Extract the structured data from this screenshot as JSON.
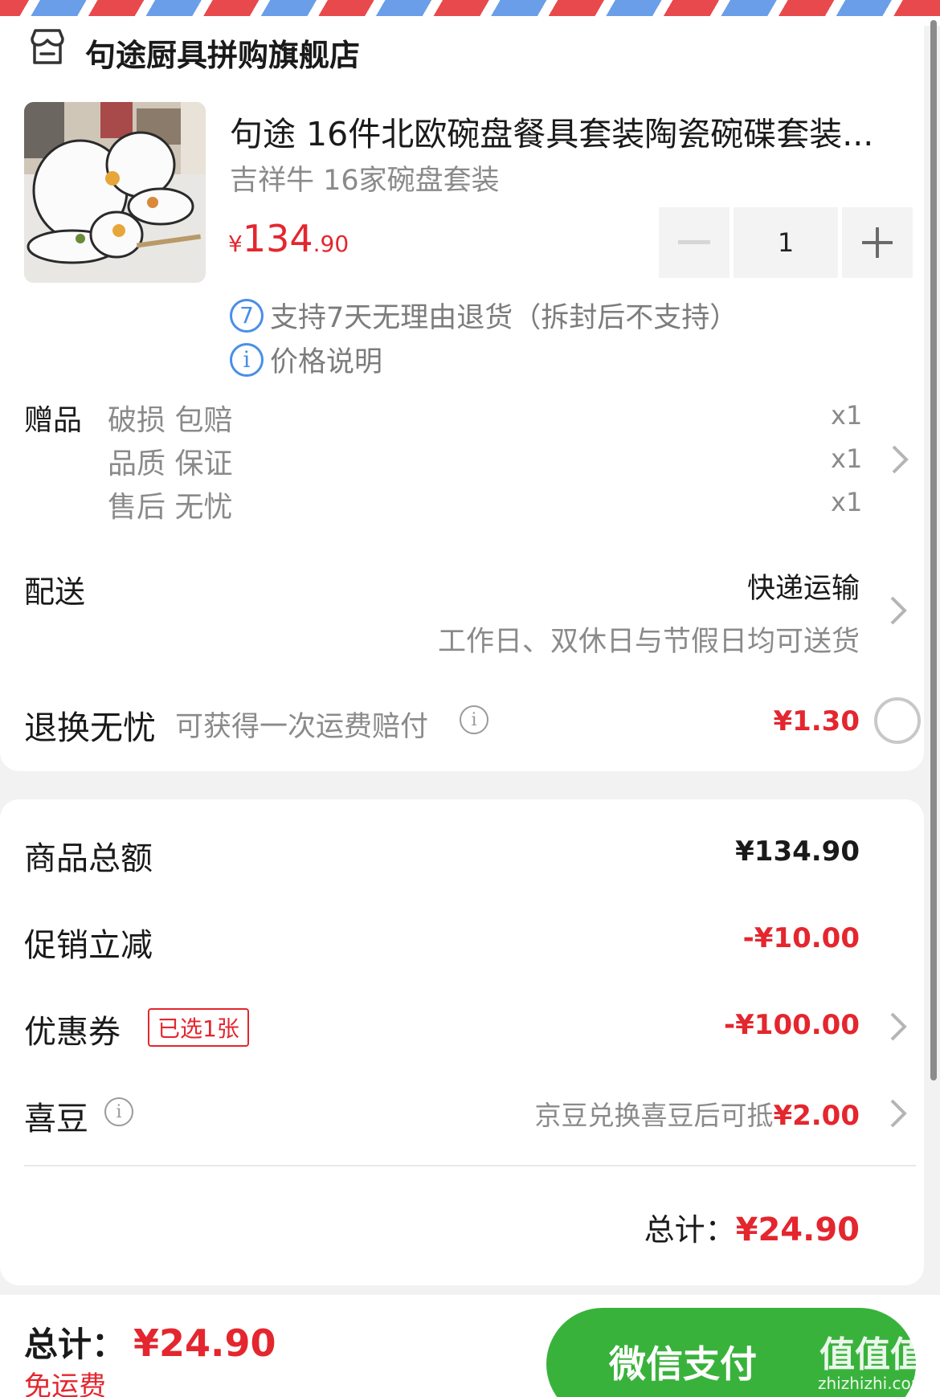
{
  "store": {
    "name": "句途厨具拼购旗舰店",
    "icon": "store-icon"
  },
  "product": {
    "title": "句途 16件北欧碗盘餐具套装陶瓷碗碟套装...",
    "spec": "吉祥牛 16家碗盘套装",
    "price_symbol": "¥",
    "price_int": "134",
    "price_dec": ".90",
    "quantity": "1",
    "return_policy": "支持7天无理由退货（拆封后不支持）",
    "return_badge": "7",
    "price_note": "价格说明"
  },
  "gifts": {
    "label": "赠品",
    "items": [
      {
        "name": "破损 包赔",
        "qty": "x1"
      },
      {
        "name": "品质 保证",
        "qty": "x1"
      },
      {
        "name": "售后 无忧",
        "qty": "x1"
      }
    ]
  },
  "delivery": {
    "label": "配送",
    "method": "快递运输",
    "note": "工作日、双休日与节假日均可送货"
  },
  "return_insurance": {
    "label": "退换无忧",
    "desc": "可获得一次运费赔付",
    "price": "¥1.30"
  },
  "summary": {
    "goods_total_label": "商品总额",
    "goods_total": "¥134.90",
    "promo_label": "促销立减",
    "promo": "-¥10.00",
    "coupon_label": "优惠券",
    "coupon_tag": "已选1张",
    "coupon": "-¥100.00",
    "beans_label": "喜豆",
    "beans_desc": "京豆兑换喜豆后可抵",
    "beans_amount": "¥2.00",
    "total_label": "总计：",
    "total": "¥24.90"
  },
  "footer": {
    "total_label": "总计：",
    "total": "¥24.90",
    "shipping": "免运费",
    "pay_button": "微信支付",
    "watermark": "值值值",
    "watermark_url": "zhizhizhi.com"
  },
  "colors": {
    "accent_red": "#e4262e",
    "pay_green": "#39b23c",
    "info_blue": "#4a8ee8"
  }
}
